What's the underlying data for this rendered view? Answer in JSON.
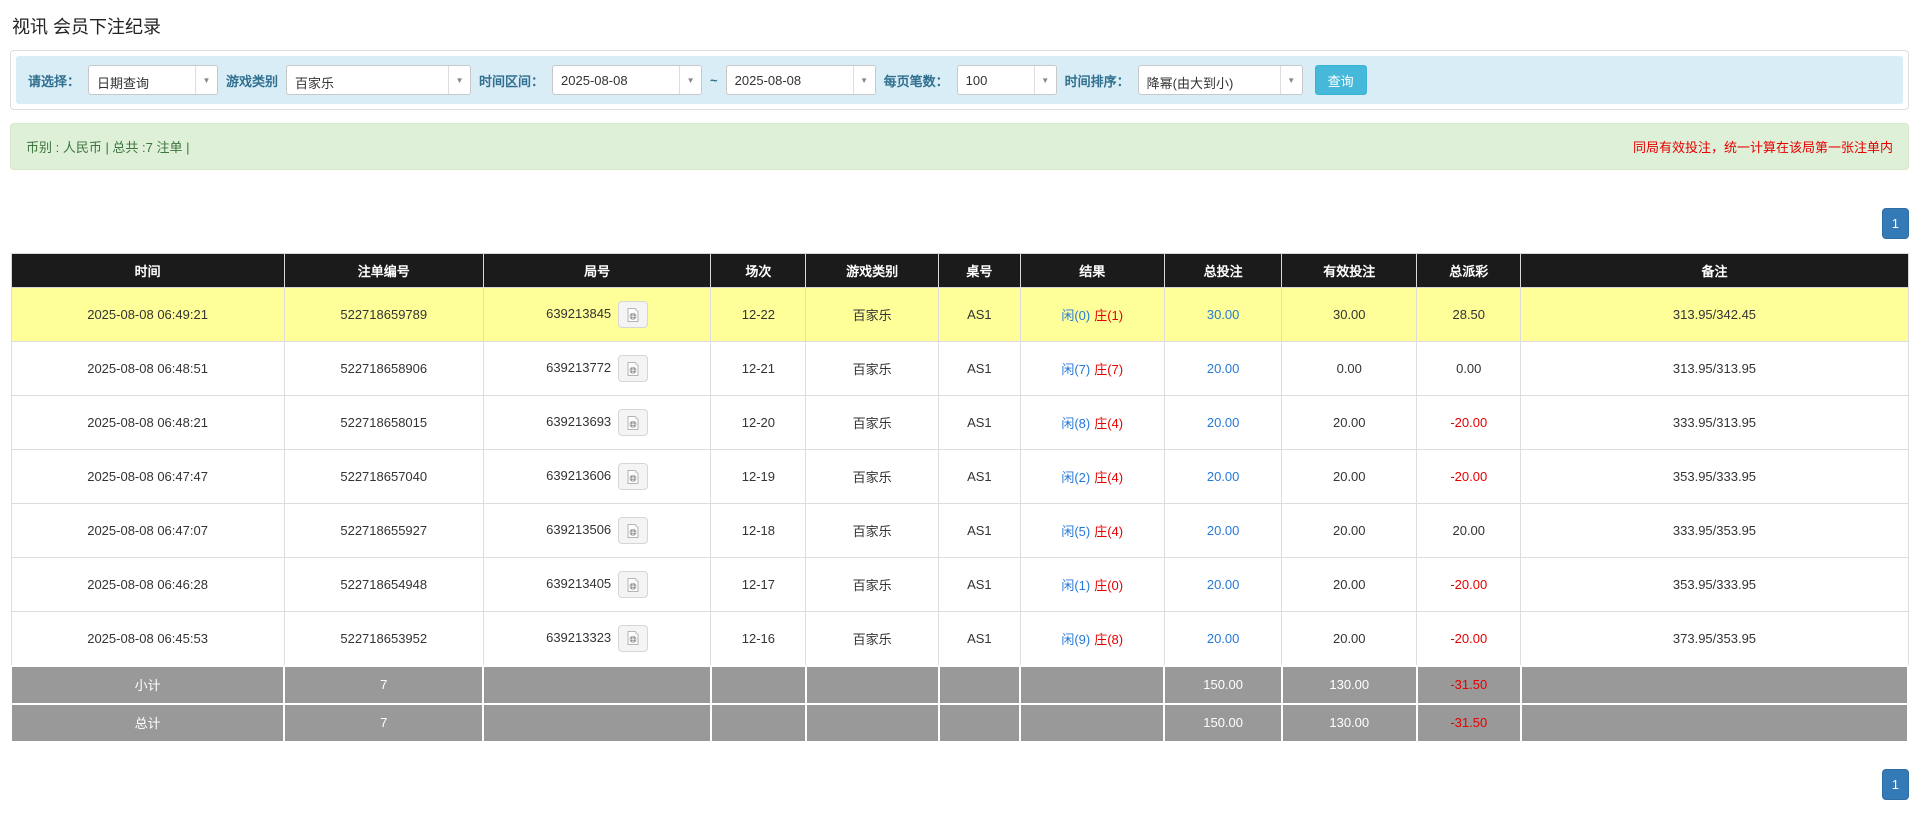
{
  "page": {
    "title": "视讯 会员下注纪录"
  },
  "colors": {
    "filter_bg": "#d9edf7",
    "label_blue": "#31708f",
    "search_btn": "#46b8da",
    "alert_bg": "#dff0d8",
    "alert_text": "#3c763d",
    "note_red": "#e60000",
    "link_blue": "#2779d8",
    "banker_red": "#e60000",
    "header_bg": "#1b1b1b",
    "highlight_row": "#ffff99",
    "summary_row": "#999999",
    "pager_blue": "#337ab7"
  },
  "filters": {
    "query_type_label": "请选择：",
    "query_type_value": "日期查询",
    "game_type_label": "游戏类别",
    "game_type_value": "百家乐",
    "time_range_label": "时间区间：",
    "date_from": "2025-08-08",
    "tilde": "~",
    "date_to": "2025-08-08",
    "page_size_label": "每页笔数：",
    "page_size_value": "100",
    "sort_label": "时间排序：",
    "sort_value": "降幂(由大到小)",
    "search_button": "查询"
  },
  "summary_bar": {
    "left": "币别 : 人民币 | 总共 :7 注单 |",
    "right_note": "同局有效投注，统一计算在该局第一张注单内"
  },
  "pagination": {
    "page": "1"
  },
  "table": {
    "headers": [
      "时间",
      "注单编号",
      "局号",
      "场次",
      "游戏类别",
      "桌号",
      "结果",
      "总投注",
      "有效投注",
      "总派彩",
      "备注"
    ],
    "rows": [
      {
        "time": "2025-08-08 06:49:21",
        "bet_no": "522718659789",
        "round_no": "639213845",
        "session": "12-22",
        "game_type": "百家乐",
        "table_no": "AS1",
        "result_player": "闲(0)",
        "result_banker": "庄(1)",
        "total_bet": "30.00",
        "valid_bet": "30.00",
        "payout": "28.50",
        "note": "313.95/342.45",
        "highlight": true
      },
      {
        "time": "2025-08-08 06:48:51",
        "bet_no": "522718658906",
        "round_no": "639213772",
        "session": "12-21",
        "game_type": "百家乐",
        "table_no": "AS1",
        "result_player": "闲(7)",
        "result_banker": "庄(7)",
        "total_bet": "20.00",
        "valid_bet": "0.00",
        "payout": "0.00",
        "note": "313.95/313.95",
        "highlight": false
      },
      {
        "time": "2025-08-08 06:48:21",
        "bet_no": "522718658015",
        "round_no": "639213693",
        "session": "12-20",
        "game_type": "百家乐",
        "table_no": "AS1",
        "result_player": "闲(8)",
        "result_banker": "庄(4)",
        "total_bet": "20.00",
        "valid_bet": "20.00",
        "payout": "-20.00",
        "note": "333.95/313.95",
        "highlight": false
      },
      {
        "time": "2025-08-08 06:47:47",
        "bet_no": "522718657040",
        "round_no": "639213606",
        "session": "12-19",
        "game_type": "百家乐",
        "table_no": "AS1",
        "result_player": "闲(2)",
        "result_banker": "庄(4)",
        "total_bet": "20.00",
        "valid_bet": "20.00",
        "payout": "-20.00",
        "note": "353.95/333.95",
        "highlight": false
      },
      {
        "time": "2025-08-08 06:47:07",
        "bet_no": "522718655927",
        "round_no": "639213506",
        "session": "12-18",
        "game_type": "百家乐",
        "table_no": "AS1",
        "result_player": "闲(5)",
        "result_banker": "庄(4)",
        "total_bet": "20.00",
        "valid_bet": "20.00",
        "payout": "20.00",
        "note": "333.95/353.95",
        "highlight": false
      },
      {
        "time": "2025-08-08 06:46:28",
        "bet_no": "522718654948",
        "round_no": "639213405",
        "session": "12-17",
        "game_type": "百家乐",
        "table_no": "AS1",
        "result_player": "闲(1)",
        "result_banker": "庄(0)",
        "total_bet": "20.00",
        "valid_bet": "20.00",
        "payout": "-20.00",
        "note": "353.95/333.95",
        "highlight": false
      },
      {
        "time": "2025-08-08 06:45:53",
        "bet_no": "522718653952",
        "round_no": "639213323",
        "session": "12-16",
        "game_type": "百家乐",
        "table_no": "AS1",
        "result_player": "闲(9)",
        "result_banker": "庄(8)",
        "total_bet": "20.00",
        "valid_bet": "20.00",
        "payout": "-20.00",
        "note": "373.95/353.95",
        "highlight": false
      }
    ],
    "subtotal": {
      "label": "小计",
      "count": "7",
      "total_bet": "150.00",
      "valid_bet": "130.00",
      "payout": "-31.50"
    },
    "total": {
      "label": "总计",
      "count": "7",
      "total_bet": "150.00",
      "valid_bet": "130.00",
      "payout": "-31.50"
    }
  }
}
